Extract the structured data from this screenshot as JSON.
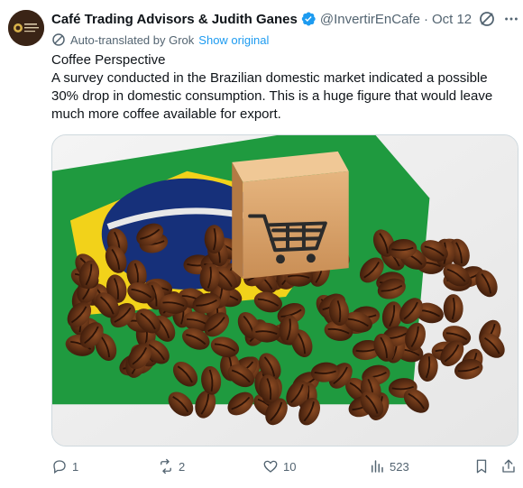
{
  "author": {
    "display_name": "Café Trading Advisors & Judith Ganes",
    "handle": "@InvertirEnCafe",
    "separator": "·",
    "date": "Oct 12",
    "avatar_text": "CAFE TRADING ADVISORS"
  },
  "translation": {
    "label": "Auto-translated by Grok",
    "show_original": "Show original"
  },
  "tweet": {
    "line1": "Coffee Perspective",
    "line2": "A survey conducted in the Brazilian domestic market indicated a possible 30% drop in domestic consumption. This is a huge figure that would leave much more coffee available for export."
  },
  "actions": {
    "replies": "1",
    "reposts": "2",
    "likes": "10",
    "views": "523"
  },
  "icons": {
    "verified": "verified-badge-icon",
    "grok": "grok-icon",
    "more": "more-icon",
    "translate": "translate-icon",
    "reply": "reply-icon",
    "repost": "repost-icon",
    "like": "heart-icon",
    "views": "views-icon",
    "bookmark": "bookmark-icon",
    "share": "share-icon"
  },
  "colors": {
    "link": "#1d9bf0",
    "secondary_text": "#536471",
    "verified": "#1d9bf0",
    "flag_green": "#1f9a3f",
    "flag_yellow": "#f2d21a",
    "flag_blue": "#16307a"
  }
}
